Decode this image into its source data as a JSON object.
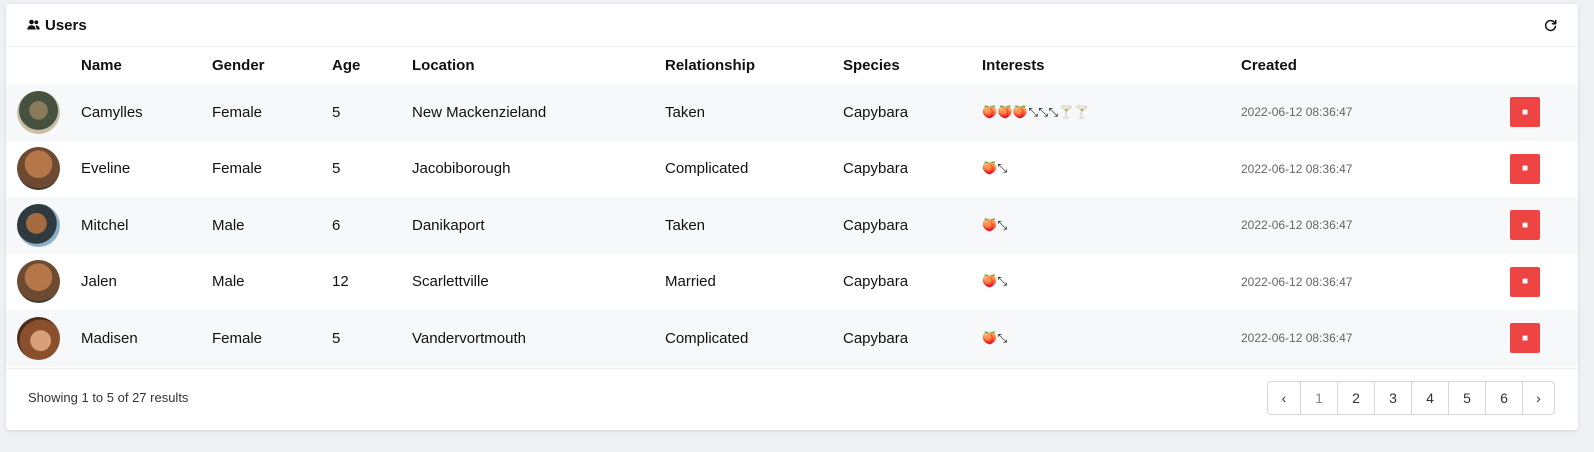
{
  "header": {
    "title": "Users"
  },
  "table": {
    "columns": [
      "Name",
      "Gender",
      "Age",
      "Location",
      "Relationship",
      "Species",
      "Interests",
      "Created"
    ],
    "rows": [
      {
        "name": "Camylles",
        "gender": "Female",
        "age": "5",
        "location": "New Mackenzieland",
        "relationship": "Taken",
        "species": "Capybara",
        "interests": "🍑🍑🍑⤡⤡⤡🍸🍸",
        "created": "2022-06-12 08:36:47"
      },
      {
        "name": "Eveline",
        "gender": "Female",
        "age": "5",
        "location": "Jacobiborough",
        "relationship": "Complicated",
        "species": "Capybara",
        "interests": "🍑⤡",
        "created": "2022-06-12 08:36:47"
      },
      {
        "name": "Mitchel",
        "gender": "Male",
        "age": "6",
        "location": "Danikaport",
        "relationship": "Taken",
        "species": "Capybara",
        "interests": "🍑⤡",
        "created": "2022-06-12 08:36:47"
      },
      {
        "name": "Jalen",
        "gender": "Male",
        "age": "12",
        "location": "Scarlettville",
        "relationship": "Married",
        "species": "Capybara",
        "interests": "🍑⤡",
        "created": "2022-06-12 08:36:47"
      },
      {
        "name": "Madisen",
        "gender": "Female",
        "age": "5",
        "location": "Vandervortmouth",
        "relationship": "Complicated",
        "species": "Capybara",
        "interests": "🍑⤡",
        "created": "2022-06-12 08:36:47"
      }
    ]
  },
  "footer": {
    "showing_text": "Showing 1 to 5 of 27 results",
    "pages": [
      "1",
      "2",
      "3",
      "4",
      "5",
      "6"
    ],
    "prev_label": "‹",
    "next_label": "›"
  },
  "colors": {
    "delete": "#ef4444",
    "row_alt": "#f6f8fa",
    "page_bg": "#eef0f3"
  },
  "icons": {
    "title": "users-icon",
    "refresh": "refresh-icon",
    "delete": "trash-icon"
  }
}
